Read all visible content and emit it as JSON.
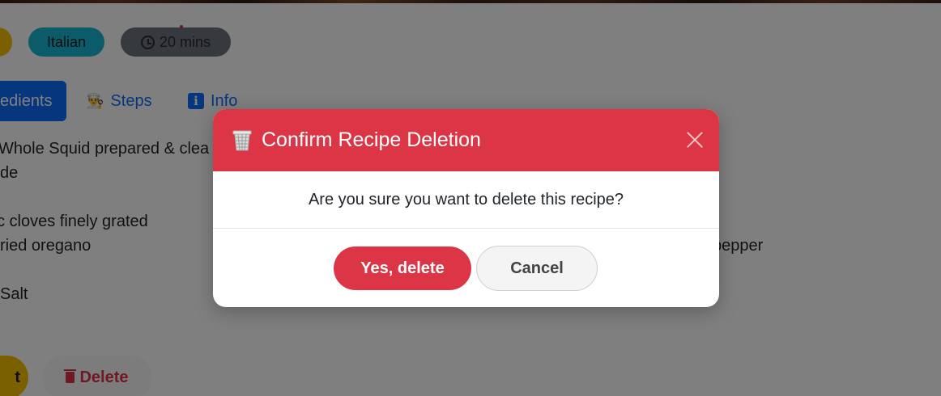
{
  "recipe": {
    "tags": {
      "cuisine": "Italian",
      "time": "20 mins"
    },
    "tabs": {
      "ingredients": "edients",
      "steps": "Steps",
      "info": "Info"
    },
    "ingredients_left": [
      "Whole Squid prepared & clea",
      "de",
      "c cloves finely grated",
      "ried oregano",
      "Salt"
    ],
    "ingredients_right": [
      "pepper"
    ],
    "actions": {
      "edit": "t",
      "delete": "Delete"
    }
  },
  "modal": {
    "title": "Confirm Recipe Deletion",
    "message": "Are you sure you want to delete this recipe?",
    "confirm_label": "Yes, delete",
    "cancel_label": "Cancel",
    "header_color": "#dc3545"
  }
}
